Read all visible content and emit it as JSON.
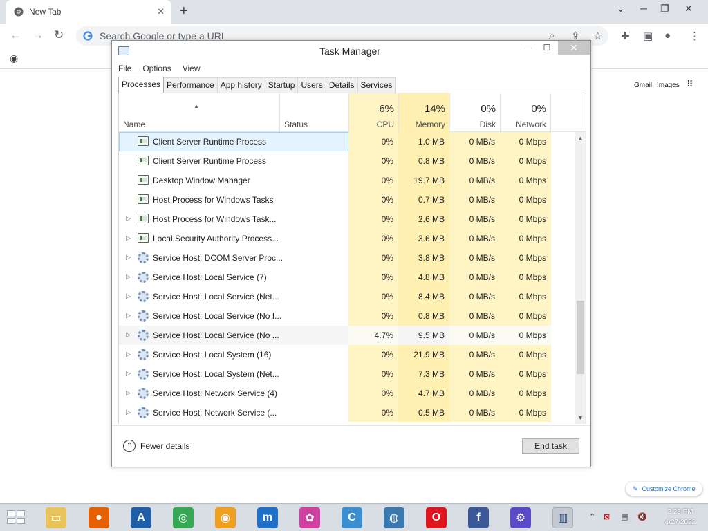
{
  "browser": {
    "tab_title": "New Tab",
    "omnibox_placeholder": "Search Google or type a URL",
    "ntp_links": {
      "gmail": "Gmail",
      "images": "Images"
    },
    "customize_label": "Customize Chrome"
  },
  "task_manager": {
    "title": "Task Manager",
    "menu": [
      "File",
      "Options",
      "View"
    ],
    "tabs": [
      "Processes",
      "Performance",
      "App history",
      "Startup",
      "Users",
      "Details",
      "Services"
    ],
    "active_tab": "Processes",
    "header": {
      "name": "Name",
      "status": "Status",
      "cpu": {
        "pct": "6%",
        "label": "CPU"
      },
      "memory": {
        "pct": "14%",
        "label": "Memory"
      },
      "disk": {
        "pct": "0%",
        "label": "Disk"
      },
      "network": {
        "pct": "0%",
        "label": "Network"
      }
    },
    "processes": [
      {
        "name": "Client Server Runtime Process",
        "icon": "window-icon",
        "expandable": false,
        "cpu": "0%",
        "memory": "1.0 MB",
        "disk": "0 MB/s",
        "network": "0 Mbps",
        "selected": true
      },
      {
        "name": "Client Server Runtime Process",
        "icon": "window-icon",
        "expandable": false,
        "cpu": "0%",
        "memory": "0.8 MB",
        "disk": "0 MB/s",
        "network": "0 Mbps"
      },
      {
        "name": "Desktop Window Manager",
        "icon": "window-icon",
        "expandable": false,
        "cpu": "0%",
        "memory": "19.7 MB",
        "disk": "0 MB/s",
        "network": "0 Mbps"
      },
      {
        "name": "Host Process for Windows Tasks",
        "icon": "window-icon",
        "expandable": false,
        "cpu": "0%",
        "memory": "0.7 MB",
        "disk": "0 MB/s",
        "network": "0 Mbps"
      },
      {
        "name": "Host Process for Windows Task...",
        "icon": "window-icon",
        "expandable": true,
        "cpu": "0%",
        "memory": "2.6 MB",
        "disk": "0 MB/s",
        "network": "0 Mbps"
      },
      {
        "name": "Local Security Authority Process...",
        "icon": "window-icon",
        "expandable": true,
        "cpu": "0%",
        "memory": "3.6 MB",
        "disk": "0 MB/s",
        "network": "0 Mbps"
      },
      {
        "name": "Service Host: DCOM Server Proc...",
        "icon": "gear-icon",
        "expandable": true,
        "cpu": "0%",
        "memory": "3.8 MB",
        "disk": "0 MB/s",
        "network": "0 Mbps"
      },
      {
        "name": "Service Host: Local Service (7)",
        "icon": "gear-icon",
        "expandable": true,
        "cpu": "0%",
        "memory": "4.8 MB",
        "disk": "0 MB/s",
        "network": "0 Mbps"
      },
      {
        "name": "Service Host: Local Service (Net...",
        "icon": "gear-icon",
        "expandable": true,
        "cpu": "0%",
        "memory": "8.4 MB",
        "disk": "0 MB/s",
        "network": "0 Mbps"
      },
      {
        "name": "Service Host: Local Service (No I...",
        "icon": "gear-icon",
        "expandable": true,
        "cpu": "0%",
        "memory": "0.8 MB",
        "disk": "0 MB/s",
        "network": "0 Mbps"
      },
      {
        "name": "Service Host: Local Service (No ...",
        "icon": "gear-icon",
        "expandable": true,
        "cpu": "4.7%",
        "memory": "9.5 MB",
        "disk": "0 MB/s",
        "network": "0 Mbps",
        "hover": true
      },
      {
        "name": "Service Host: Local System (16)",
        "icon": "gear-icon",
        "expandable": true,
        "cpu": "0%",
        "memory": "21.9 MB",
        "disk": "0 MB/s",
        "network": "0 Mbps"
      },
      {
        "name": "Service Host: Local System (Net...",
        "icon": "gear-icon",
        "expandable": true,
        "cpu": "0%",
        "memory": "7.3 MB",
        "disk": "0 MB/s",
        "network": "0 Mbps"
      },
      {
        "name": "Service Host: Network Service (4)",
        "icon": "gear-icon",
        "expandable": true,
        "cpu": "0%",
        "memory": "4.7 MB",
        "disk": "0 MB/s",
        "network": "0 Mbps"
      },
      {
        "name": "Service Host: Network Service (...",
        "icon": "gear-icon",
        "expandable": true,
        "cpu": "0%",
        "memory": "0.5 MB",
        "disk": "0 MB/s",
        "network": "0 Mbps"
      }
    ],
    "footer": {
      "fewer_details": "Fewer details",
      "end_task": "End task"
    }
  },
  "taskbar": {
    "apps": [
      "file-explorer-icon",
      "firefox-icon",
      "app-a-icon",
      "chrome-icon",
      "vpn-icon",
      "maxthon-icon",
      "colorful-browser-icon",
      "ccleaner-icon",
      "globe-browser-icon",
      "opera-icon",
      "facebook-icon",
      "settings-icon",
      "task-manager-icon"
    ],
    "clock": {
      "time": "2:23 PM",
      "date": "4/27/2022"
    }
  },
  "colors": {
    "cpu_col": "#fff4c4",
    "memory_col": "#ffefb0",
    "selection": "#e5f3ff"
  }
}
